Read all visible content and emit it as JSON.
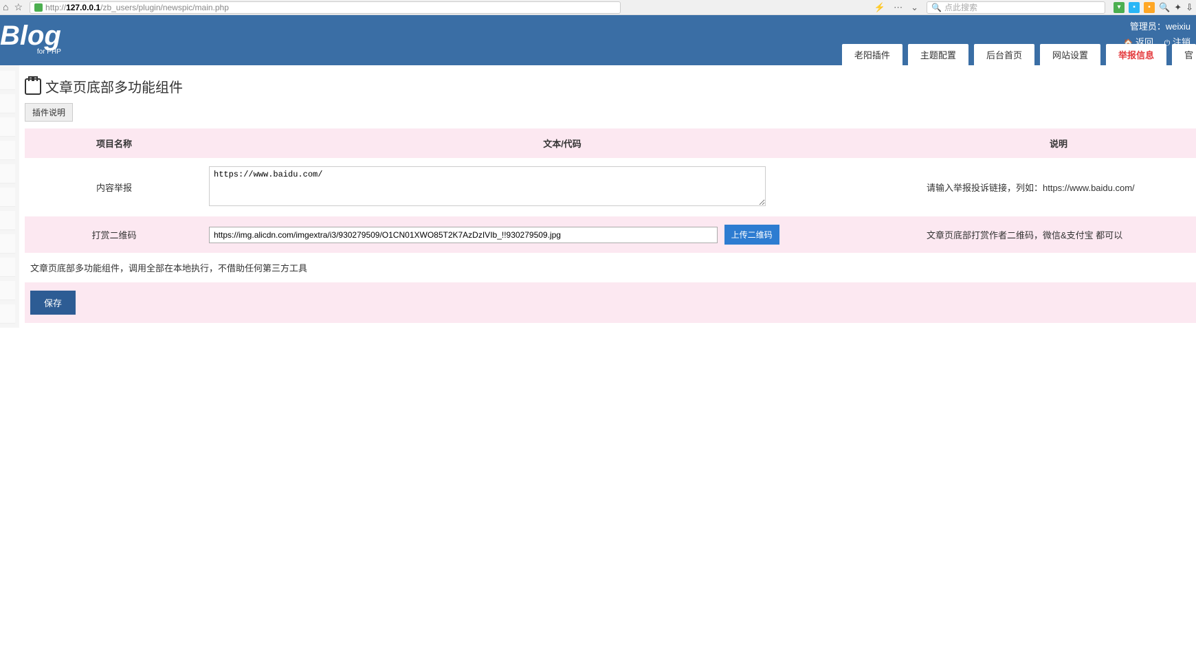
{
  "browser": {
    "url_prefix": "http://",
    "url_host": "127.0.0.1",
    "url_path": "/zb_users/plugin/newspic/main.php",
    "search_placeholder": "点此搜索"
  },
  "header": {
    "logo_main": "Blog",
    "logo_sub": "for PHP",
    "admin_label": "管理员：weixiu",
    "back_label": "返回",
    "logout_label": "注销",
    "tabs": [
      {
        "label": "老阳插件",
        "active": false
      },
      {
        "label": "主题配置",
        "active": false
      },
      {
        "label": "后台首页",
        "active": false
      },
      {
        "label": "网站设置",
        "active": false
      },
      {
        "label": "举报信息",
        "active": true
      },
      {
        "label": "官",
        "active": false
      }
    ]
  },
  "page": {
    "title": "文章页底部多功能组件",
    "plugin_desc_btn": "插件说明",
    "table_headers": {
      "name": "项目名称",
      "code": "文本/代码",
      "desc": "说明"
    },
    "rows": [
      {
        "name": "内容举报",
        "type": "textarea",
        "value": "https://www.baidu.com/",
        "desc": "请输入举报投诉链接，列如：https://www.baidu.com/"
      },
      {
        "name": "打赏二维码",
        "type": "input_upload",
        "value": "https://img.alicdn.com/imgextra/i3/930279509/O1CN01XWO85T2K7AzDzIVIb_!!930279509.jpg",
        "upload_label": "上传二维码",
        "desc": "文章页底部打赏作者二维码，微信&支付宝 都可以"
      }
    ],
    "note": "文章页底部多功能组件，调用全部在本地执行，不借助任何第三方工具",
    "save_btn": "保存"
  }
}
